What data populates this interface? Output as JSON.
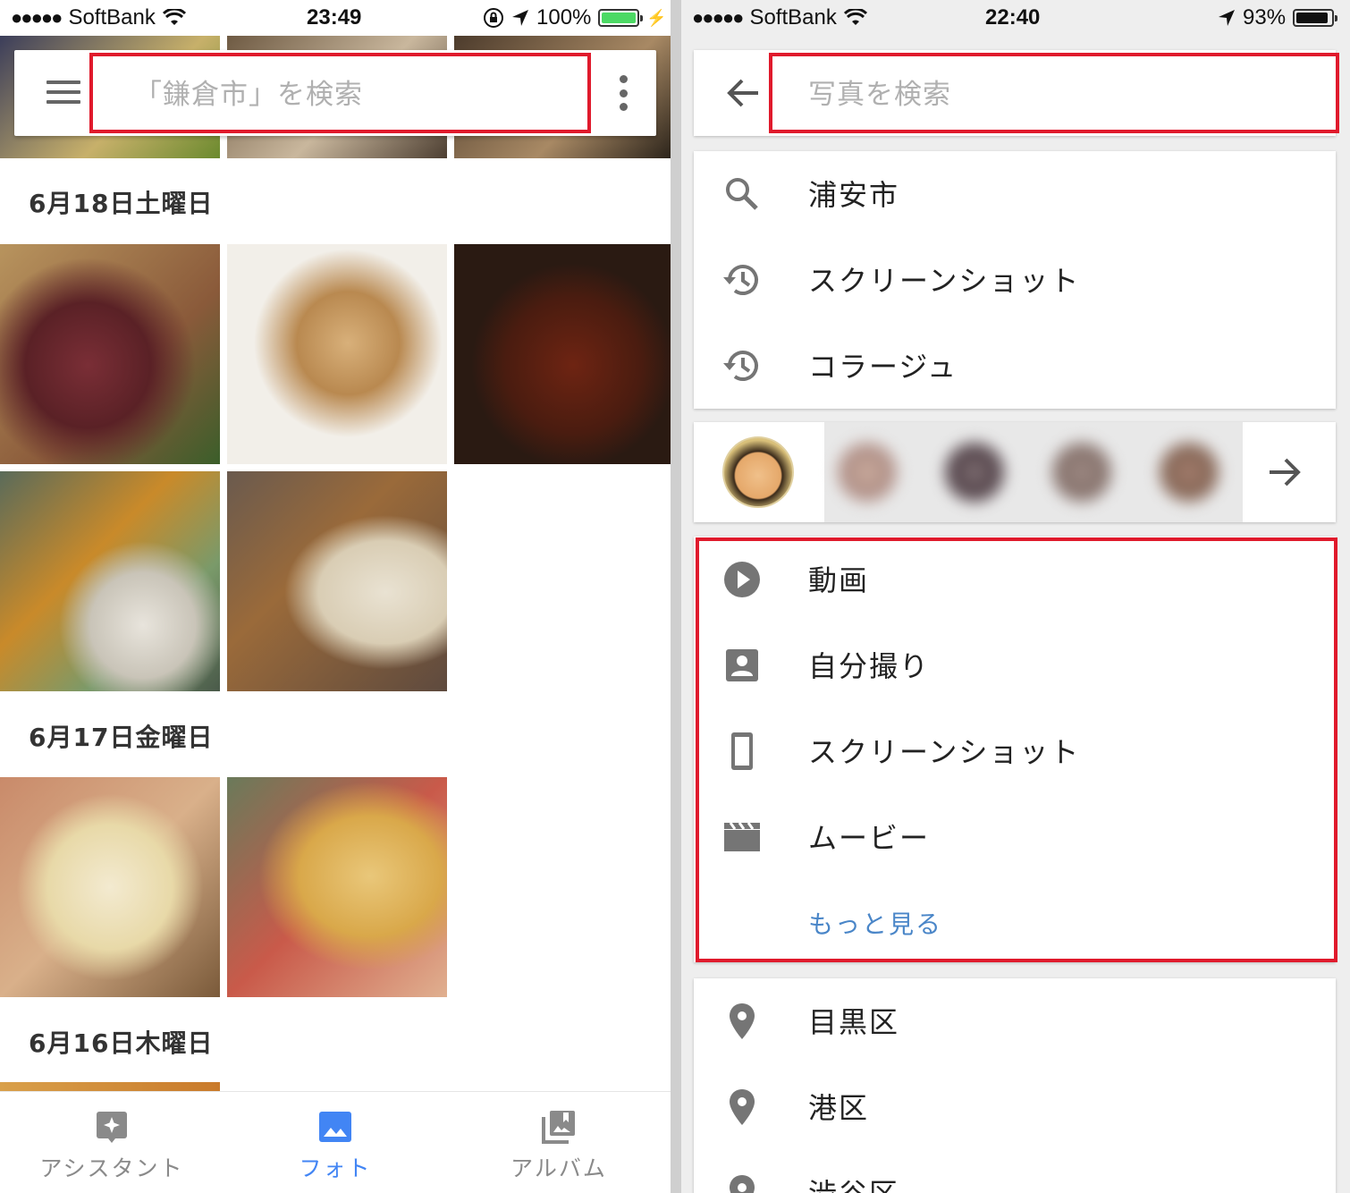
{
  "left": {
    "status": {
      "carrier": "SoftBank",
      "time": "23:49",
      "battery": "100%",
      "battery_level": 1.0,
      "battery_color": "#4cd964"
    },
    "search": {
      "placeholder": "「鎌倉市」を検索"
    },
    "sections": [
      {
        "date": "6月18日土曜日"
      },
      {
        "date": "6月17日金曜日"
      },
      {
        "date": "6月16日木曜日"
      }
    ],
    "nav": [
      {
        "label": "アシスタント",
        "icon": "assistant-icon",
        "active": false
      },
      {
        "label": "フォト",
        "icon": "photos-icon",
        "active": true
      },
      {
        "label": "アルバム",
        "icon": "albums-icon",
        "active": false
      }
    ],
    "colors": {
      "accent": "#4285f4",
      "inactive": "#8a8a8a",
      "highlight": "#e01a2c"
    }
  },
  "right": {
    "status": {
      "carrier": "SoftBank",
      "time": "22:40",
      "battery": "93%",
      "battery_level": 0.93,
      "battery_color": "#111111"
    },
    "search": {
      "placeholder": "写真を検索"
    },
    "recent": [
      {
        "label": "浦安市",
        "icon": "search-icon"
      },
      {
        "label": "スクリーンショット",
        "icon": "history-icon"
      },
      {
        "label": "コラージュ",
        "icon": "history-icon"
      }
    ],
    "categories": [
      {
        "label": "動画",
        "icon": "play-circle-icon"
      },
      {
        "label": "自分撮り",
        "icon": "portrait-icon"
      },
      {
        "label": "スクリーンショット",
        "icon": "phone-icon"
      },
      {
        "label": "ムービー",
        "icon": "clapperboard-icon"
      }
    ],
    "more_label": "もっと見る",
    "places": [
      {
        "label": "目黒区",
        "icon": "place-icon"
      },
      {
        "label": "港区",
        "icon": "place-icon"
      },
      {
        "label": "渋谷区",
        "icon": "place-icon"
      }
    ]
  }
}
